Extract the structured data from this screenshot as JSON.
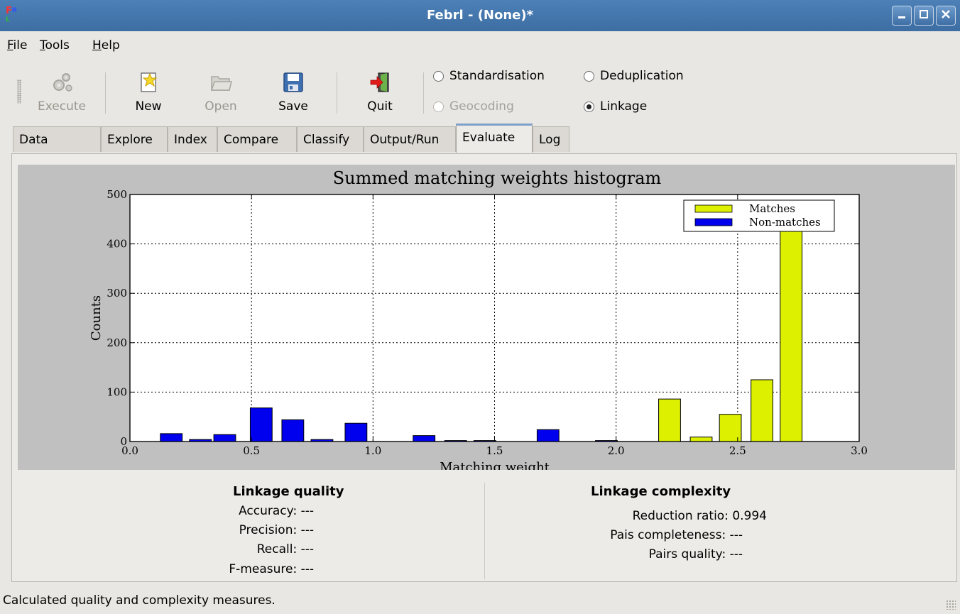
{
  "window": {
    "title": "Febrl - (None)*",
    "icon": "febrl-app-icon"
  },
  "menu": [
    {
      "mnemonic": "F",
      "rest": "ile"
    },
    {
      "mnemonic": "T",
      "rest": "ools"
    },
    {
      "mnemonic": "H",
      "rest": "elp"
    }
  ],
  "toolbar": {
    "execute_label": "Execute",
    "new_label": "New",
    "open_label": "Open",
    "save_label": "Save",
    "quit_label": "Quit"
  },
  "modes": {
    "standardisation": "Standardisation",
    "deduplication": "Deduplication",
    "geocoding": "Geocoding",
    "linkage": "Linkage",
    "selected": "Linkage"
  },
  "tabs": [
    "Data",
    "Explore",
    "Index",
    "Compare",
    "Classify",
    "Output/Run",
    "Evaluate",
    "Log"
  ],
  "active_tab": "Evaluate",
  "chart_data": {
    "type": "bar",
    "title": "Summed matching weights histogram",
    "xlabel": "Matching weight",
    "ylabel": "Counts",
    "xlim": [
      0.0,
      3.0
    ],
    "ylim": [
      0,
      500
    ],
    "xticks": [
      "0.0",
      "0.5",
      "1.0",
      "1.5",
      "2.0",
      "2.5",
      "3.0"
    ],
    "yticks": [
      "0",
      "100",
      "200",
      "300",
      "400",
      "500"
    ],
    "grid": true,
    "legend": "top-right",
    "bar_width": 0.09,
    "series": [
      {
        "name": "Matches",
        "color": "#dcf000",
        "x": [
          2.22,
          2.35,
          2.47,
          2.6,
          2.72
        ],
        "values": [
          86,
          9,
          55,
          125,
          450
        ]
      },
      {
        "name": "Non-matches",
        "color": "#0000ee",
        "x": [
          0.17,
          0.29,
          0.39,
          0.54,
          0.67,
          0.79,
          0.93,
          1.21,
          1.34,
          1.46,
          1.72,
          1.96
        ],
        "values": [
          16,
          4,
          14,
          68,
          44,
          4,
          37,
          12,
          2,
          2,
          24,
          2
        ]
      }
    ]
  },
  "quality": {
    "title": "Linkage quality",
    "accuracy": "Accuracy: ---",
    "precision": "Precision: ---",
    "recall": "Recall: ---",
    "fmeasure": "F-measure: ---"
  },
  "complexity": {
    "title": "Linkage complexity",
    "reduction": "Reduction ratio: 0.994",
    "completeness": "Pais completeness: ---",
    "quality": "Pairs quality: ---"
  },
  "status": "Calculated quality and complexity measures."
}
